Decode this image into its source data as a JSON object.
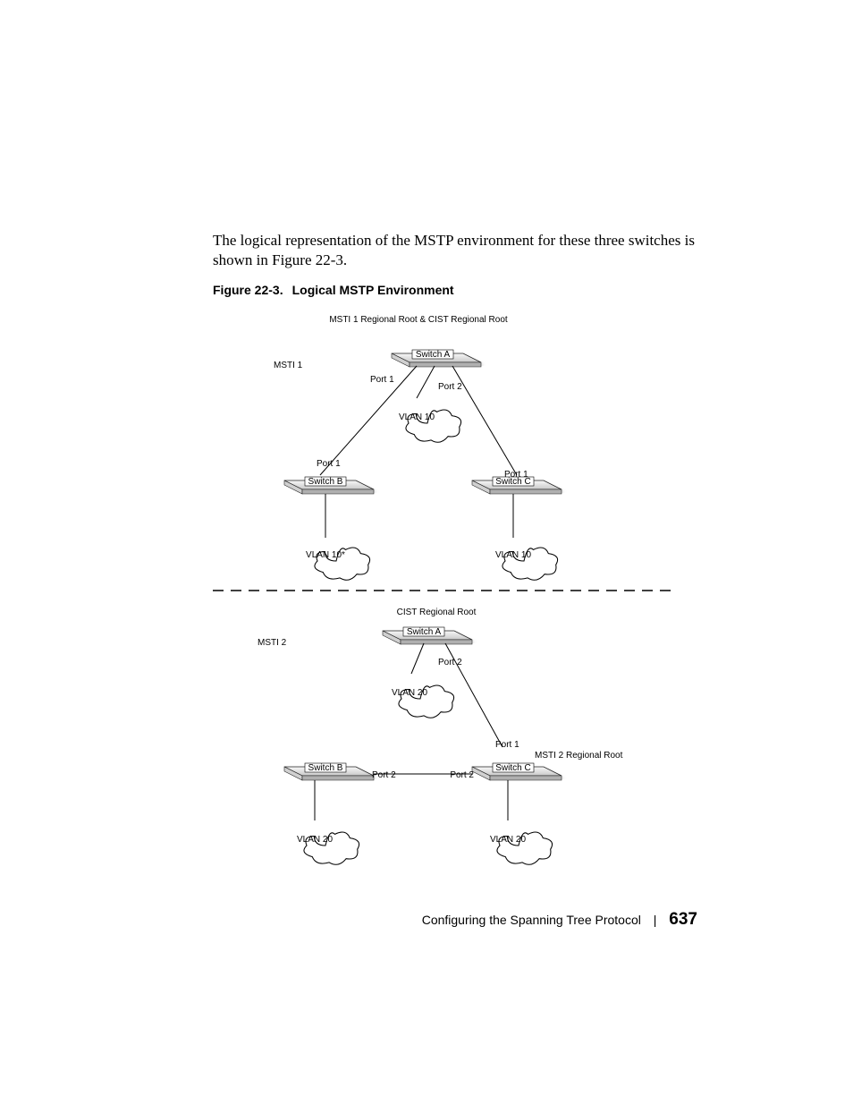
{
  "paragraph": "The logical representation of the MSTP environment for these three switches is shown in Figure 22-3.",
  "figure": {
    "number": "Figure 22-3.",
    "title": "Logical MSTP Environment",
    "top_header": "MSTI 1 Regional Root & CIST Regional Root",
    "msti1_label": "MSTI 1",
    "msti2_label": "MSTI 2",
    "cist_label": "CIST Regional Root",
    "msti2_root_label": "MSTI 2 Regional Root",
    "switches": {
      "a": "Switch A",
      "b": "Switch B",
      "c": "Switch C"
    },
    "ports": {
      "p1": "Port 1",
      "p2": "Port 2"
    },
    "vlans": {
      "v10": "VLAN 10",
      "v10star": "VLAN 10*",
      "v20": "VLAN 20"
    }
  },
  "footer": {
    "chapter": "Configuring the Spanning Tree Protocol",
    "page": "637"
  }
}
